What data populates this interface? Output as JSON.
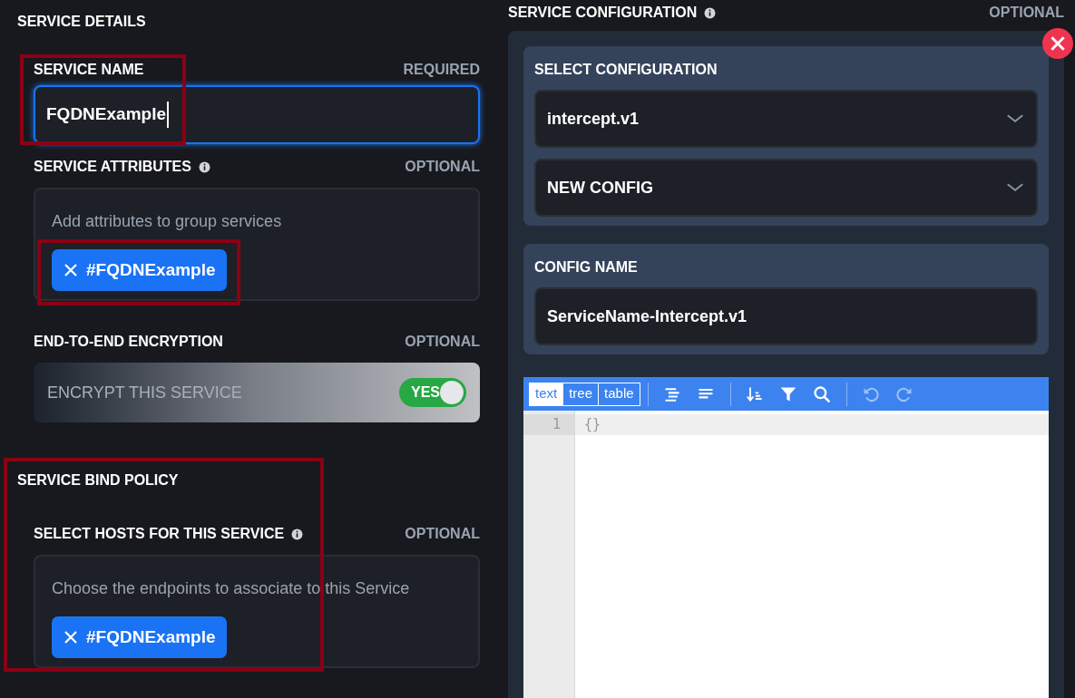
{
  "details": {
    "title": "SERVICE DETAILS",
    "service_name": {
      "label": "SERVICE NAME",
      "tag": "REQUIRED",
      "value": "FQDNExample",
      "focused": true
    },
    "attributes": {
      "label": "SERVICE ATTRIBUTES",
      "tag": "OPTIONAL",
      "placeholder": "Add attributes to group services",
      "chips": [
        "#FQDNExample"
      ]
    },
    "encryption": {
      "label": "END-TO-END ENCRYPTION",
      "tag": "OPTIONAL",
      "text": "ENCRYPT THIS SERVICE",
      "toggle": {
        "label": "YES",
        "on": true
      }
    }
  },
  "bind_policy": {
    "title": "SERVICE BIND POLICY",
    "label": "SELECT HOSTS FOR THIS SERVICE",
    "tag": "OPTIONAL",
    "placeholder": "Choose the endpoints to associate to this Service",
    "chips": [
      "#FQDNExample"
    ]
  },
  "configuration": {
    "title": "SERVICE CONFIGURATION",
    "tag": "OPTIONAL",
    "select_label": "SELECT CONFIGURATION",
    "selects": [
      "intercept.v1",
      "NEW CONFIG"
    ],
    "name_label": "CONFIG NAME",
    "name_value": "ServiceName-Intercept.v1",
    "editor": {
      "modes": [
        {
          "label": "text",
          "selected": true
        },
        {
          "label": "tree",
          "selected": false
        },
        {
          "label": "table",
          "selected": false
        }
      ],
      "lines": [
        {
          "number": "1",
          "text": "{}"
        }
      ]
    }
  }
}
